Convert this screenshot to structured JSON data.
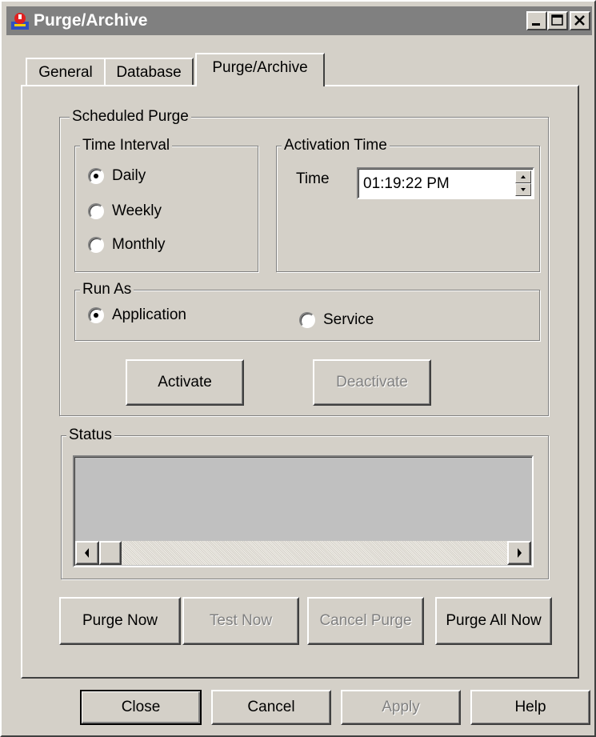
{
  "window": {
    "title": "Purge/Archive"
  },
  "tabs": [
    {
      "label": "General"
    },
    {
      "label": "Database"
    },
    {
      "label": "Purge/Archive"
    }
  ],
  "scheduled_purge": {
    "label": "Scheduled Purge",
    "time_interval": {
      "label": "Time Interval",
      "options": [
        "Daily",
        "Weekly",
        "Monthly"
      ],
      "selected": "Daily"
    },
    "activation_time": {
      "label": "Activation Time",
      "time_label": "Time",
      "time_value": "01:19:22 PM"
    },
    "run_as": {
      "label": "Run As",
      "options": [
        "Application",
        "Service"
      ],
      "selected": "Application"
    },
    "activate_label": "Activate",
    "deactivate_label": "Deactivate"
  },
  "status": {
    "label": "Status"
  },
  "actions": {
    "purge_now": "Purge Now",
    "test_now": "Test Now",
    "cancel_purge": "Cancel Purge",
    "purge_all_now": "Purge All Now"
  },
  "footer": {
    "close": "Close",
    "cancel": "Cancel",
    "apply": "Apply",
    "help": "Help"
  }
}
